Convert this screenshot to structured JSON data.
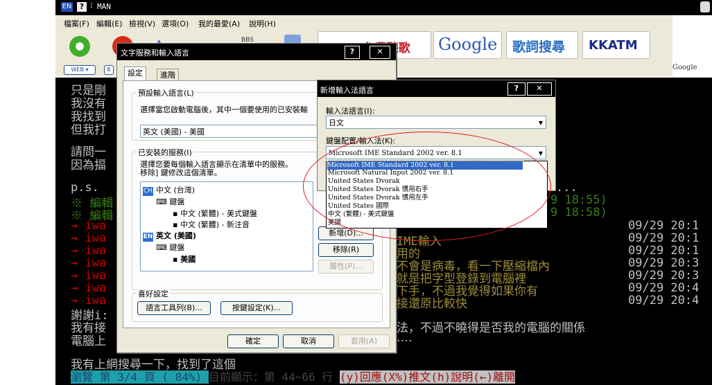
{
  "topbar": {
    "lang_badge": "EN",
    "help_badge": "?",
    "title": "MAN"
  },
  "menu": [
    "檔案(F)",
    "編輯(E)",
    "檢視(V)",
    "選項(O)",
    "我的最愛(A)",
    "說明(H)"
  ],
  "toolbar": {
    "pill1": "WEB ▾",
    "pill2": "B",
    "bbs": "BBS",
    "ad": "hifree免費聽歌",
    "banners": [
      "Google",
      "歌詞搜尋",
      "KKATM"
    ],
    "right_text": "Google"
  },
  "terminal": {
    "lines": [
      {
        "text": "只是剛",
        "color": "gray"
      },
      {
        "text": "我沒有",
        "color": "gray"
      },
      {
        "text": "我找到",
        "color": "gray"
      },
      {
        "text": "但我打",
        "color": "gray"
      },
      {
        "text": "請問一",
        "color": "gray"
      },
      {
        "text": "因為揊",
        "color": "gray"
      },
      {
        "text": "p.s.",
        "color": "gray"
      },
      {
        "text": "※  編輯",
        "color": "green"
      },
      {
        "text": "※  編輯",
        "color": "green"
      },
      {
        "text": "→  iwa",
        "color": "red"
      },
      {
        "text": "→  iwa",
        "color": "red"
      },
      {
        "text": "→  iwa",
        "color": "red"
      },
      {
        "text": "→  iwa",
        "color": "red"
      },
      {
        "text": "→  iwa",
        "color": "red"
      },
      {
        "text": "→  iwa",
        "color": "red"
      },
      {
        "text": "→  iwa",
        "color": "red"
      },
      {
        "text": "謝謝i:",
        "color": "gray"
      },
      {
        "text": "我有接",
        "color": "gray"
      },
      {
        "text": "電腦上",
        "color": "gray"
      }
    ],
    "right_bits": [
      {
        "text": "...",
        "color": "gray"
      },
      {
        "text": "9  18:55)",
        "color": "green"
      },
      {
        "text": "9  18:58)",
        "color": "green"
      }
    ],
    "comments": [
      {
        "text": "IME輸入",
        "time": "09/29 20:1"
      },
      {
        "text": "用的",
        "time": "09/29 20:1"
      },
      {
        "text": "不會是病毒，看一下壓縮檔內",
        "time": "09/29 20:3"
      },
      {
        "text": "就是把字型登錄到電腦裡",
        "time": "09/29 20:3"
      },
      {
        "text": "下手，不過我覺得如果你有",
        "time": "09/29 20:4"
      },
      {
        "text": "接還原比較快",
        "time": "09/29 20:4"
      }
    ],
    "line_fa": "法，不過不曉得是否我的電腦的關係",
    "line_dots": "‥‥",
    "last_line": "我有上網搜尋一下，找到了這個",
    "status": {
      "browse": "  瀏覽  第 3/4 頁 ( 84%) ",
      "showing": " 目前顯示：第 44~66 行 ",
      "keys": " (y)回應(X%)推文(h)說明(←)離開"
    }
  },
  "dialog1": {
    "title": "文字服務和輸入語言",
    "tabs": [
      "設定",
      "進階"
    ],
    "default_group": "預設輸入語言(L)",
    "default_desc": "選擇當您啟動電腦後，其中一個要使用的已安裝輸",
    "default_value": "英文 (美國) - 美國",
    "installed_group": "已安裝的服務(I)",
    "installed_desc1": "選擇您要每個輸入語言顯示在清單中的服務。",
    "installed_desc2": "移除] 鍵修改這個清單。",
    "tree": {
      "ch_badge": "CH",
      "ch_label": "中文 (台灣)",
      "kb1": "鍵盤",
      "ch_items": [
        "中文 (繁體) - 美式鍵盤",
        "中文 (繁體) - 新注音"
      ],
      "en_badge": "EN",
      "en_label": "英文 (美國)",
      "kb2": "鍵盤",
      "en_items": [
        "美國"
      ]
    },
    "add_button": "新增(D)...",
    "remove_button": "移除(R)",
    "props_button": "屬性(P)...",
    "prefs_group": "喜好設定",
    "langbar_button": "語言工具列(B)...",
    "keys_button": "按鍵設定(K)...",
    "ok": "確定",
    "cancel": "取消",
    "apply": "套用(A)"
  },
  "dialog2": {
    "title": "新增輸入法語言",
    "lang_label": "輸入法語言(I):",
    "lang_value": "日文",
    "kb_label": "鍵盤配置/輸入法(K):",
    "kb_value": "Microsoft IME Standard 2002 ver. 8.1",
    "options": [
      "Microsoft IME Standard 2002 ver. 8.1",
      "Microsoft Natural Input 2002 ver. 8.1",
      "United States Dvorak",
      "United States Dvorak 慣用右手",
      "United States Dvorak 慣用左手",
      "United States 國際",
      "中文 (繁體) - 美式鍵盤",
      "美國"
    ]
  },
  "colors": {
    "terminal_bg": "#000000",
    "highlight": "#316ac5",
    "annotation": "#e21a1a"
  }
}
